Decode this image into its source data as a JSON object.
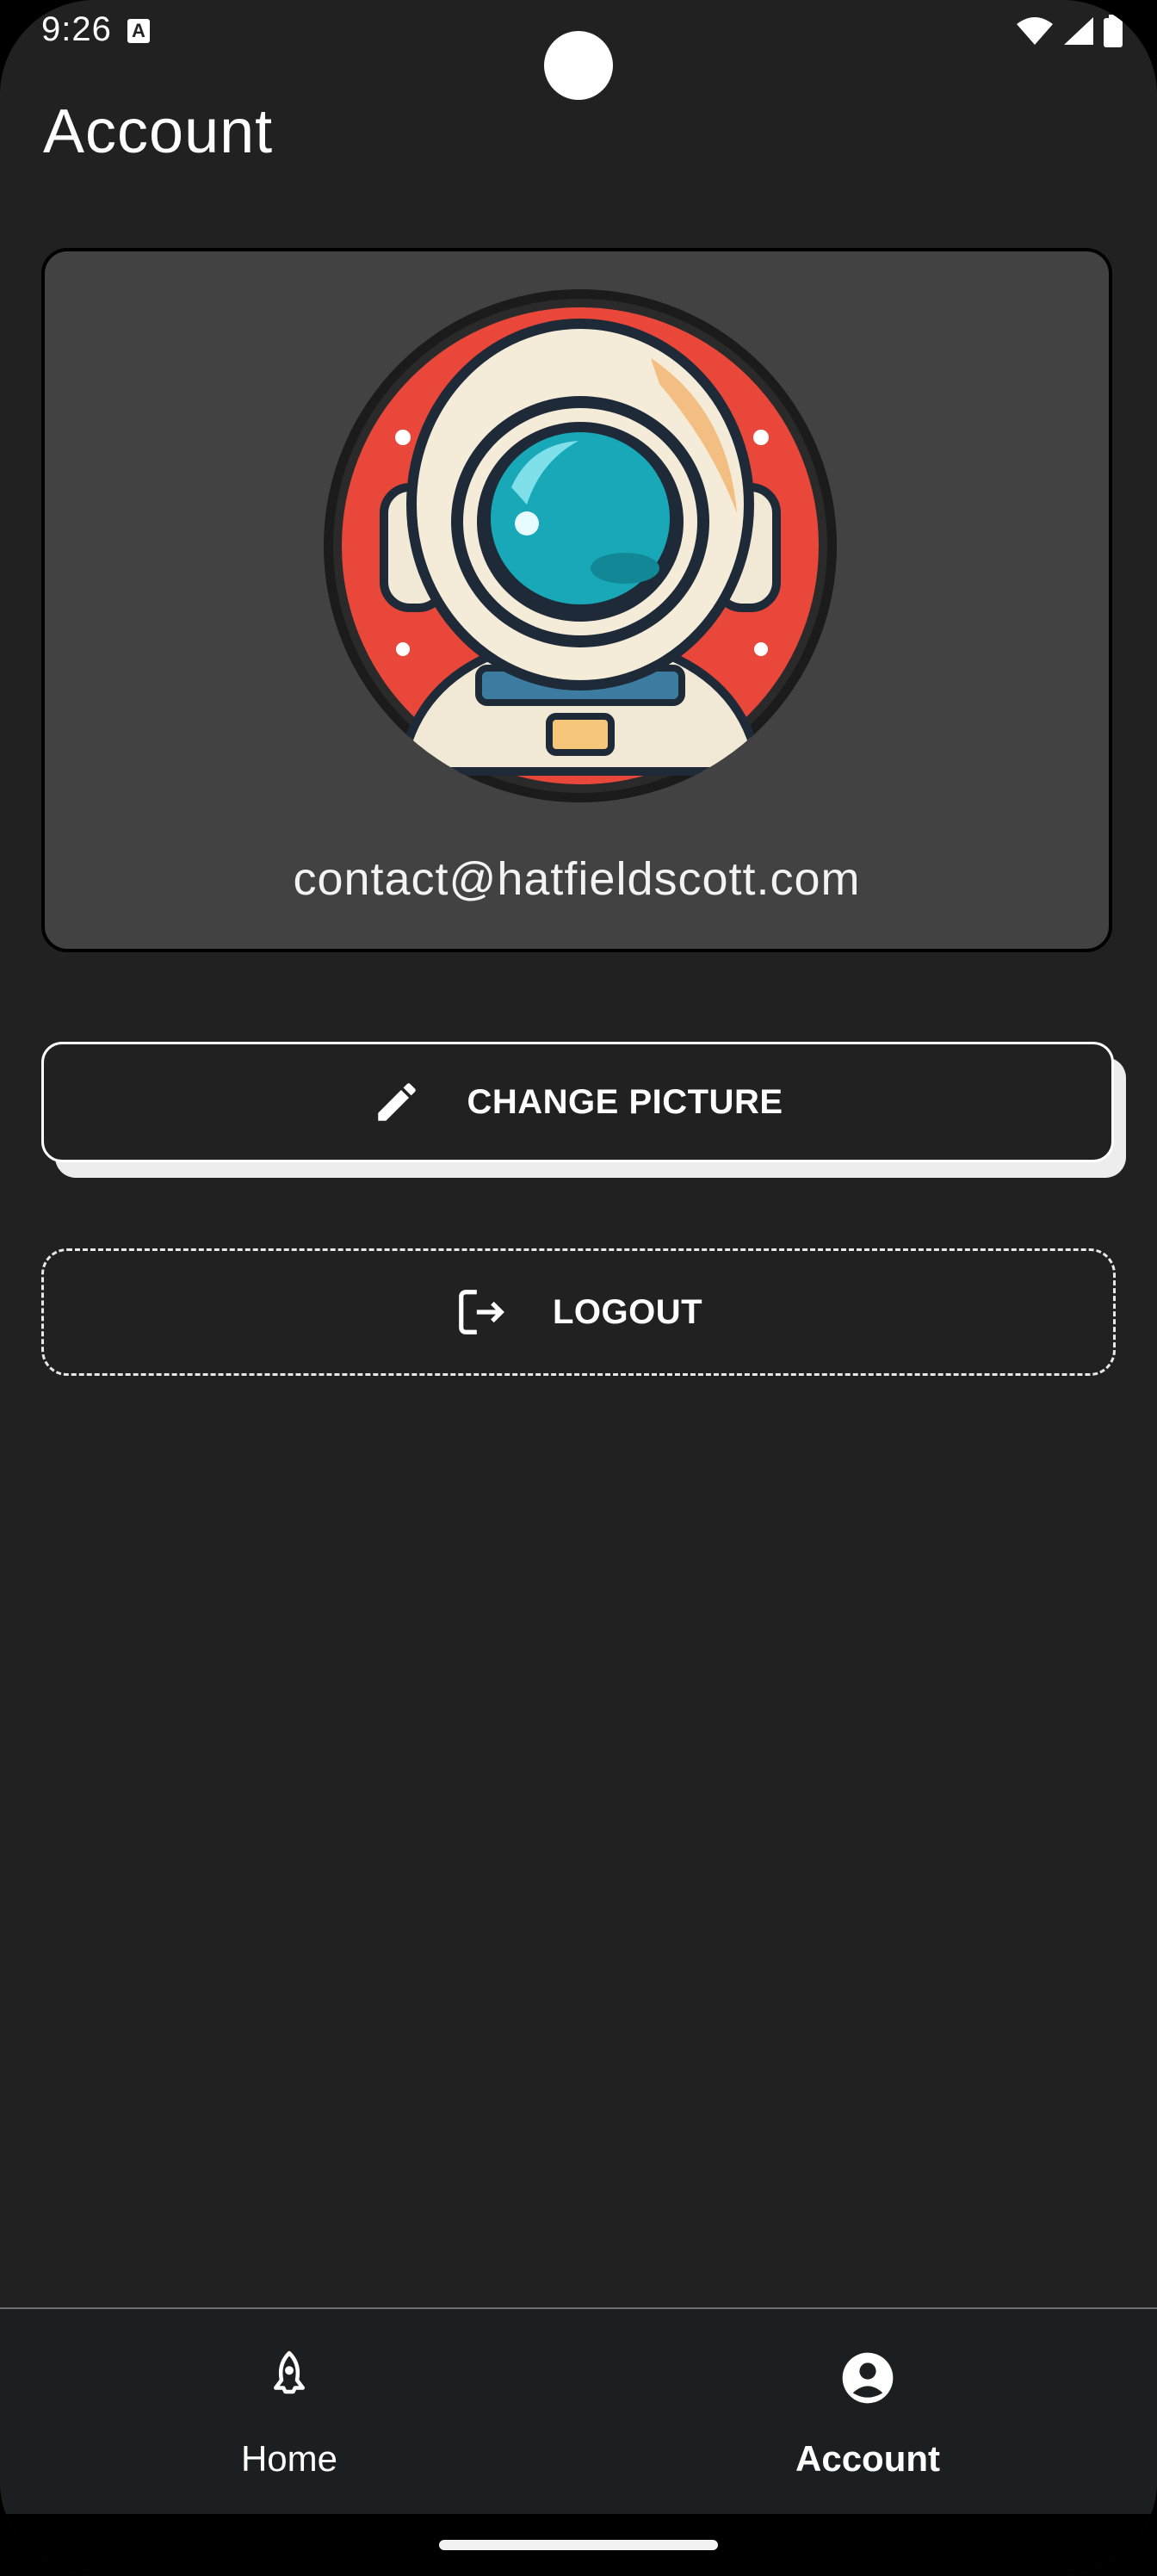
{
  "status_bar": {
    "time": "9:26",
    "notification_icon": "a-icon",
    "icons": [
      "wifi-icon",
      "signal-icon",
      "battery-icon"
    ]
  },
  "header": {
    "title": "Account"
  },
  "profile": {
    "avatar": "astronaut-avatar",
    "email": "contact@hatfieldscott.com"
  },
  "actions": {
    "change_picture": {
      "label": "CHANGE PICTURE",
      "icon": "pencil-icon"
    },
    "logout": {
      "label": "LOGOUT",
      "icon": "logout-icon"
    }
  },
  "bottom_nav": {
    "items": [
      {
        "label": "Home",
        "icon": "rocket-icon",
        "active": false
      },
      {
        "label": "Account",
        "icon": "account-circle-icon",
        "active": true
      }
    ]
  },
  "colors": {
    "background": "#212121",
    "card": "#424242",
    "nav": "#1c1f21",
    "avatar_ring": "#e8473a",
    "visor": "#18a8b8"
  }
}
